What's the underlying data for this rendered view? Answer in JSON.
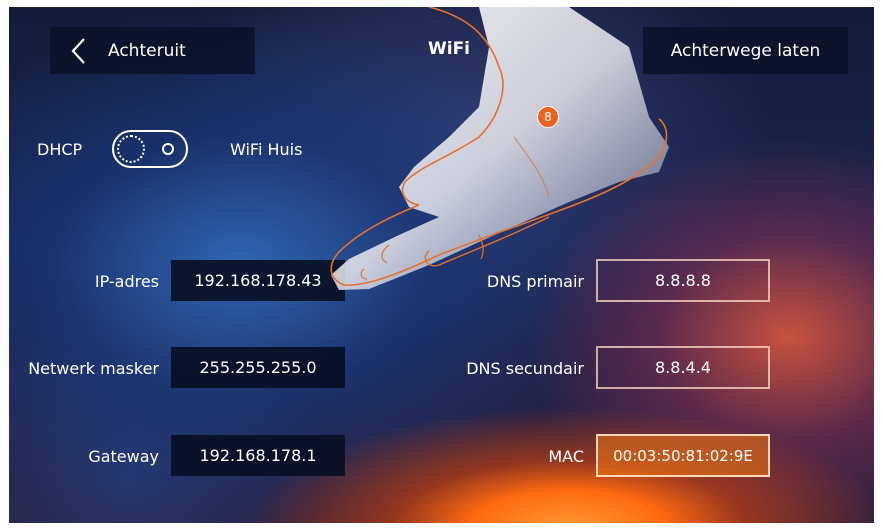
{
  "header": {
    "back_label": "Achteruit",
    "title": "WiFi",
    "skip_label": "Achterwege laten"
  },
  "dhcp": {
    "label": "DHCP",
    "network_name": "WiFi Huis"
  },
  "left_fields": [
    {
      "label": "IP-adres",
      "value": "192.168.178.43"
    },
    {
      "label": "Netwerk masker",
      "value": "255.255.255.0"
    },
    {
      "label": "Gateway",
      "value": "192.168.178.1"
    }
  ],
  "right_fields": [
    {
      "label": "DNS primair",
      "value": "8.8.8.8"
    },
    {
      "label": "DNS secundair",
      "value": "8.8.4.4"
    },
    {
      "label": "MAC",
      "value": "00:03:50:81:02:9E"
    }
  ],
  "callout": {
    "number": "8"
  },
  "colors": {
    "accent": "#e8641c",
    "panel": "#0a1228"
  }
}
